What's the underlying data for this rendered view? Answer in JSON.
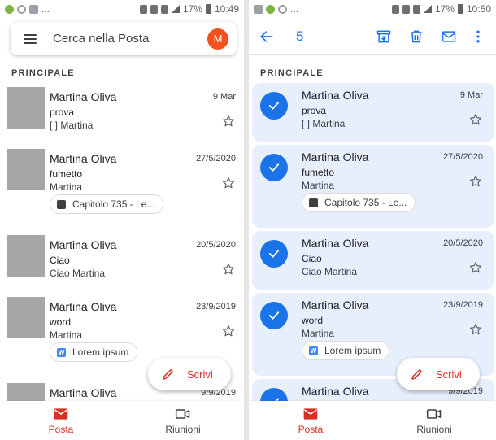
{
  "status_left": {
    "time": "10:49",
    "battery": "17%",
    "dots": "..."
  },
  "status_right": {
    "time": "10:50",
    "battery": "17%",
    "dots": "..."
  },
  "search": {
    "placeholder": "Cerca nella Posta",
    "avatar_letter": "M"
  },
  "selection": {
    "count": "5"
  },
  "section_label": "PRINCIPALE",
  "messages": [
    {
      "sender": "Martina Oliva",
      "date": "9 Mar",
      "subject": "prova",
      "snippet": "[ ] Martina"
    },
    {
      "sender": "Martina Oliva",
      "date": "27/5/2020",
      "subject": "fumetto",
      "snippet": "Martina",
      "attachment": "Capitolo 735 - Le..."
    },
    {
      "sender": "Martina Oliva",
      "date": "20/5/2020",
      "subject": "Ciao",
      "snippet": "Ciao Martina"
    },
    {
      "sender": "Martina Oliva",
      "date": "23/9/2019",
      "subject": "word",
      "snippet": "Martina",
      "attachment": "Lorem ipsum"
    },
    {
      "sender": "Martina Oliva",
      "date": "9/9/2019"
    }
  ],
  "compose_label": "Scrivi",
  "nav": {
    "mail_label": "Posta",
    "meet_label": "Riunioni"
  },
  "colors": {
    "accent_blue": "#1a73e8",
    "accent_red": "#d93025",
    "selected_row": "#e8effc",
    "avatar": "#f4511e"
  },
  "icons": {
    "menu": "menu-icon",
    "back": "arrow-back-icon",
    "archive": "archive-icon",
    "delete": "trash-icon",
    "unread": "mail-icon",
    "more": "more-vert-icon",
    "star": "star-outline-icon",
    "check": "check-icon",
    "compose": "pencil-icon",
    "mail_nav": "mail-filled-icon",
    "meet_nav": "video-icon"
  }
}
